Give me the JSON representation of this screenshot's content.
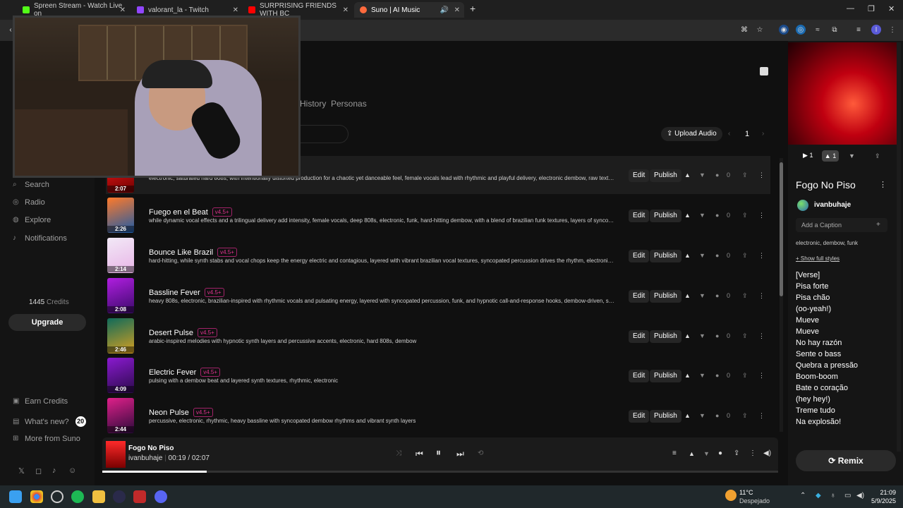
{
  "tabs": [
    {
      "label": "Spreen Stream - Watch Live on",
      "color": "#53fc18"
    },
    {
      "label": "valorant_la - Twitch",
      "color": "#9146ff"
    },
    {
      "label": "SURPRISING FRIENDS WITH BC",
      "color": "#ff0000"
    },
    {
      "label": "Suno | AI Music",
      "color": "#ff6a3d"
    }
  ],
  "page": {
    "tabs": [
      "History",
      "Personas"
    ],
    "upload_label": "Upload Audio",
    "page_number": "1"
  },
  "sidebar": {
    "nav": [
      {
        "label": "Search",
        "icon": "search-icon"
      },
      {
        "label": "Radio",
        "icon": "radio-icon"
      },
      {
        "label": "Explore",
        "icon": "explore-icon"
      },
      {
        "label": "Notifications",
        "icon": "bell-icon"
      }
    ],
    "credits_number": "1445",
    "credits_label": "Credits",
    "upgrade_label": "Upgrade",
    "footer": [
      {
        "label": "Earn Credits",
        "icon": "gift-icon"
      },
      {
        "label": "What's new?",
        "icon": "news-icon",
        "badge": "20"
      },
      {
        "label": "More from Suno",
        "icon": "grid-icon"
      }
    ]
  },
  "songs": [
    {
      "title": "",
      "version": "",
      "duration": "2:07",
      "desc": "electronic, saturated hard 808s, with intentionally distorted production for a chaotic yet danceable feel, female vocals lead with rhythmic and playful delivery, electronic dembow, raw texture, brazili...",
      "comments": "0",
      "colors": [
        "#ff1a1a",
        "#6a0000"
      ]
    },
    {
      "title": "Fuego en el Beat",
      "version": "v4.5+",
      "duration": "2:26",
      "desc": "while dynamic vocal effects and a trilingual delivery add intensity, female vocals, deep 808s, electronic, funk, hard-hitting dembow, with a blend of brazilian funk textures, layers of syncopated percu...",
      "comments": "0",
      "colors": [
        "#ff7a2a",
        "#1a5aa8"
      ]
    },
    {
      "title": "Bounce Like Brazil",
      "version": "v4.5+",
      "duration": "2:14",
      "desc": "hard-hitting, while synth stabs and vocal chops keep the energy electric and contagious, layered with vibrant brazilian vocal textures, syncopated percussion drives the rhythm, electronic, funk, de...",
      "comments": "0",
      "colors": [
        "#f2e9f7",
        "#e8b4e6"
      ]
    },
    {
      "title": "Bassline Fever",
      "version": "v4.5+",
      "duration": "2:08",
      "desc": "heavy 808s, electronic, brazilian-inspired with rhythmic vocals and pulsating energy, layered with syncopated percussion, funk, and hypnotic call-and-response hooks, dembow-driven, synth stabs",
      "comments": "0",
      "colors": [
        "#b01ee0",
        "#3a0a6a"
      ]
    },
    {
      "title": "Desert Pulse",
      "version": "v4.5+",
      "duration": "2:46",
      "desc": "arabic-inspired melodies with hypnotic synth layers and percussive accents, electronic, hard 808s, dembow",
      "comments": "0",
      "colors": [
        "#0f6a5a",
        "#d8a020"
      ]
    },
    {
      "title": "Electric Fever",
      "version": "v4.5+",
      "duration": "4:09",
      "desc": "pulsing with a dembow beat and layered synth textures, rhythmic, electronic",
      "comments": "0",
      "colors": [
        "#8a1ad0",
        "#2a0a4a"
      ]
    },
    {
      "title": "Neon Pulse",
      "version": "v4.5+",
      "duration": "2:44",
      "desc": "percussive, electronic, rhythmic, heavy bassline with syncopated dembow rhythms and vibrant synth layers",
      "comments": "0",
      "colors": [
        "#e0208a",
        "#2a0a3a"
      ]
    }
  ],
  "row_actions": {
    "edit": "Edit",
    "publish": "Publish"
  },
  "player": {
    "title": "Fogo No Piso",
    "artist": "ivanbuhaje",
    "current": "00:19",
    "separator": "/",
    "total": "02:07",
    "progress": 0.155
  },
  "right_panel": {
    "play_count": "1",
    "like_count": "1",
    "title": "Fogo No Piso",
    "artist": "ivanbuhaje",
    "caption_label": "Add a Caption",
    "styles": "electronic, dembow, funk",
    "show_styles": "Show full styles",
    "lyrics": [
      "[Verse]",
      "Pisa forte",
      "Pisa chão",
      "(oo-yeah!)",
      "Mueve",
      "Mueve",
      "No hay razón",
      "Sente o bass",
      "Quebra a pressão",
      "Boom-boom",
      "Bate o coração",
      "(hey hey!)",
      "Treme tudo",
      "Na explosão!"
    ],
    "remix_label": "Remix"
  },
  "taskbar": {
    "temp": "11°C",
    "weather": "Despejado",
    "time": "21:09",
    "date": "5/9/2025"
  }
}
